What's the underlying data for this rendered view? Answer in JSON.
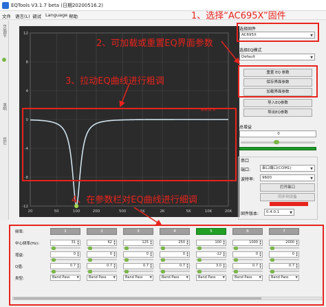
{
  "window": {
    "title": "EQTools V3.1.7 beta (日期20200516.2)"
  },
  "menu": [
    "文件",
    "语言(L)",
    "调试",
    "Language",
    "帮助"
  ],
  "tabs": [
    "EQ调节",
    "混响",
    "其它"
  ],
  "annotations": {
    "a1": "1、选择“AC695X”固件",
    "a2": "2、可加载或重置EQ界面参数",
    "a3": "3、拉动EQ曲线进行粗调",
    "a4": "4、在参数栏对EQ曲线进行细调"
  },
  "chart": {
    "type": "line",
    "y_ticks": [
      "12",
      "8",
      "4",
      "0",
      "-4",
      "-8",
      "-12"
    ],
    "x_ticks": [
      "20",
      "50",
      "100",
      "200",
      "500",
      "1K",
      "2K",
      "5K",
      "10K",
      "20K"
    ],
    "ylim": [
      -12,
      12
    ],
    "xlim": [
      20,
      20000
    ],
    "curve": {
      "center_hz": 100,
      "gain_db": -12,
      "q": 3.0
    },
    "highlight_label": "Band 6",
    "grid": true,
    "line_color": "#cfe3ee",
    "point_color": "#a4d64a"
  },
  "right_panel": {
    "firmware_label": "选择固件",
    "firmware_value": "AC695X",
    "eq_type_label": "选择EQ模式",
    "eq_type_value": "Default",
    "buttons": [
      "重置 EQ 参数",
      "保存界面参数",
      "加载界面参数",
      "导入EQ参数",
      "导出EQ参数"
    ],
    "gain_label": "总增益",
    "gain_value": "0",
    "serial_label": "串口",
    "port_label": "端口:",
    "port_value": "串口端口(COM1)",
    "baud_label": "波特率:",
    "baud_value": "9600",
    "open_button": "打开串口",
    "sync_button": "同步到设备",
    "version_label": "固件版本:",
    "version_value": "0.4.0.1"
  },
  "params": {
    "row_labels": [
      "频率:",
      "中心频率(Hz):",
      "增益:",
      "Q值:",
      "类型:"
    ],
    "bands": [
      {
        "header": "1",
        "freq": "31",
        "gain": "0",
        "q": "0.7",
        "type": "Band Pass"
      },
      {
        "header": "2",
        "freq": "62",
        "gain": "0",
        "q": "0.7",
        "type": "Band Pass"
      },
      {
        "header": "3",
        "freq": "125",
        "gain": "0",
        "q": "0.7",
        "type": "Band Pass"
      },
      {
        "header": "4",
        "freq": "250",
        "gain": "0",
        "q": "0.7",
        "type": "Band Pass"
      },
      {
        "header": "5",
        "freq": "100",
        "gain": "-12",
        "q": "3.0",
        "type": "Band Pass"
      },
      {
        "header": "6",
        "freq": "1000",
        "gain": "0",
        "q": "0.7",
        "type": "Band Pass"
      },
      {
        "header": "7",
        "freq": "2000",
        "gain": "0",
        "q": "0.7",
        "type": "Band Pass"
      }
    ],
    "active_band": 4
  }
}
